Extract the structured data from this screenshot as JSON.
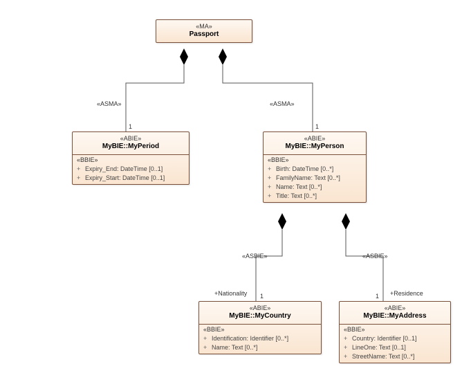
{
  "boxes": {
    "passport": {
      "stereo": "«MA»",
      "title": "Passport"
    },
    "myperiod": {
      "stereo": "«ABIE»",
      "title": "MyBIE::MyPeriod",
      "compart_label": "«BBIE»",
      "attrs": [
        {
          "vis": "+",
          "text": "Expiry_End: DateTime [0..1]"
        },
        {
          "vis": "+",
          "text": "Expiry_Start: DateTime [0..1]"
        }
      ]
    },
    "myperson": {
      "stereo": "«ABIE»",
      "title": "MyBIE::MyPerson",
      "compart_label": "«BBIE»",
      "attrs": [
        {
          "vis": "+",
          "text": "Birth: DateTime [0..*]"
        },
        {
          "vis": "+",
          "text": "FamilyName: Text [0..*]"
        },
        {
          "vis": "+",
          "text": "Name: Text [0..*]"
        },
        {
          "vis": "+",
          "text": "Title: Text [0..*]"
        }
      ]
    },
    "mycountry": {
      "stereo": "«ABIE»",
      "title": "MyBIE::MyCountry",
      "compart_label": "«BBIE»",
      "attrs": [
        {
          "vis": "+",
          "text": "Identification: Identifier [0..*]"
        },
        {
          "vis": "+",
          "text": "Name: Text [0..*]"
        }
      ]
    },
    "myaddress": {
      "stereo": "«ABIE»",
      "title": "MyBIE::MyAddress",
      "compart_label": "«BBIE»",
      "attrs": [
        {
          "vis": "+",
          "text": "Country: Identifier [0..1]"
        },
        {
          "vis": "+",
          "text": "LineOne: Text [0..1]"
        },
        {
          "vis": "+",
          "text": "StreetName: Text [0..*]"
        }
      ]
    }
  },
  "labels": {
    "asma_left": "«ASMA»",
    "asma_right": "«ASMA»",
    "asbie_left": "«ASBIE»",
    "asbie_right": "«ASBIE»",
    "one_myperiod": "1",
    "one_myperson": "1",
    "one_mycountry": "1",
    "one_myaddress": "1",
    "role_nationality": "+Nationality",
    "role_residence": "+Residence"
  },
  "chart_data": {
    "type": "uml-class-diagram",
    "classes": [
      {
        "name": "Passport",
        "stereotype": "MA",
        "attributes": []
      },
      {
        "name": "MyBIE::MyPeriod",
        "stereotype": "ABIE",
        "attr_stereotype": "BBIE",
        "attributes": [
          {
            "vis": "+",
            "name": "Expiry_End",
            "type": "DateTime",
            "mult": "[0..1]"
          },
          {
            "vis": "+",
            "name": "Expiry_Start",
            "type": "DateTime",
            "mult": "[0..1]"
          }
        ]
      },
      {
        "name": "MyBIE::MyPerson",
        "stereotype": "ABIE",
        "attr_stereotype": "BBIE",
        "attributes": [
          {
            "vis": "+",
            "name": "Birth",
            "type": "DateTime",
            "mult": "[0..*]"
          },
          {
            "vis": "+",
            "name": "FamilyName",
            "type": "Text",
            "mult": "[0..*]"
          },
          {
            "vis": "+",
            "name": "Name",
            "type": "Text",
            "mult": "[0..*]"
          },
          {
            "vis": "+",
            "name": "Title",
            "type": "Text",
            "mult": "[0..*]"
          }
        ]
      },
      {
        "name": "MyBIE::MyCountry",
        "stereotype": "ABIE",
        "attr_stereotype": "BBIE",
        "attributes": [
          {
            "vis": "+",
            "name": "Identification",
            "type": "Identifier",
            "mult": "[0..*]"
          },
          {
            "vis": "+",
            "name": "Name",
            "type": "Text",
            "mult": "[0..*]"
          }
        ]
      },
      {
        "name": "MyBIE::MyAddress",
        "stereotype": "ABIE",
        "attr_stereotype": "BBIE",
        "attributes": [
          {
            "vis": "+",
            "name": "Country",
            "type": "Identifier",
            "mult": "[0..1]"
          },
          {
            "vis": "+",
            "name": "LineOne",
            "type": "Text",
            "mult": "[0..1]"
          },
          {
            "vis": "+",
            "name": "StreetName",
            "type": "Text",
            "mult": "[0..*]"
          }
        ]
      }
    ],
    "associations": [
      {
        "from": "Passport",
        "to": "MyBIE::MyPeriod",
        "type": "composition",
        "stereotype": "ASMA",
        "mult_to": "1"
      },
      {
        "from": "Passport",
        "to": "MyBIE::MyPerson",
        "type": "composition",
        "stereotype": "ASMA",
        "mult_to": "1"
      },
      {
        "from": "MyBIE::MyPerson",
        "to": "MyBIE::MyCountry",
        "type": "composition",
        "stereotype": "ASBIE",
        "role_to": "+Nationality",
        "mult_to": "1"
      },
      {
        "from": "MyBIE::MyPerson",
        "to": "MyBIE::MyAddress",
        "type": "composition",
        "stereotype": "ASBIE",
        "role_to": "+Residence",
        "mult_to": "1"
      }
    ]
  }
}
